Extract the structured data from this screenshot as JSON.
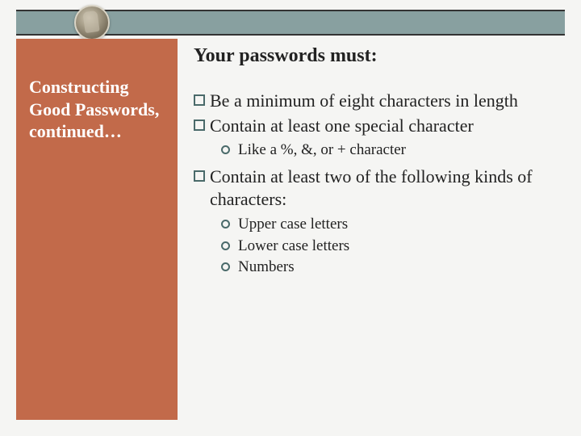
{
  "sidebar": {
    "title": "Constructing Good Passwords, continued…"
  },
  "main": {
    "heading": "Your passwords must:",
    "items": [
      {
        "text": "Be a minimum of eight characters in length",
        "sub": []
      },
      {
        "text": "Contain at least one special character",
        "sub": [
          "Like a %, &, or + character"
        ]
      },
      {
        "text": "Contain at least two of the following kinds of characters:",
        "sub": [
          "Upper case letters",
          "Lower case letters",
          "Numbers"
        ]
      }
    ]
  }
}
